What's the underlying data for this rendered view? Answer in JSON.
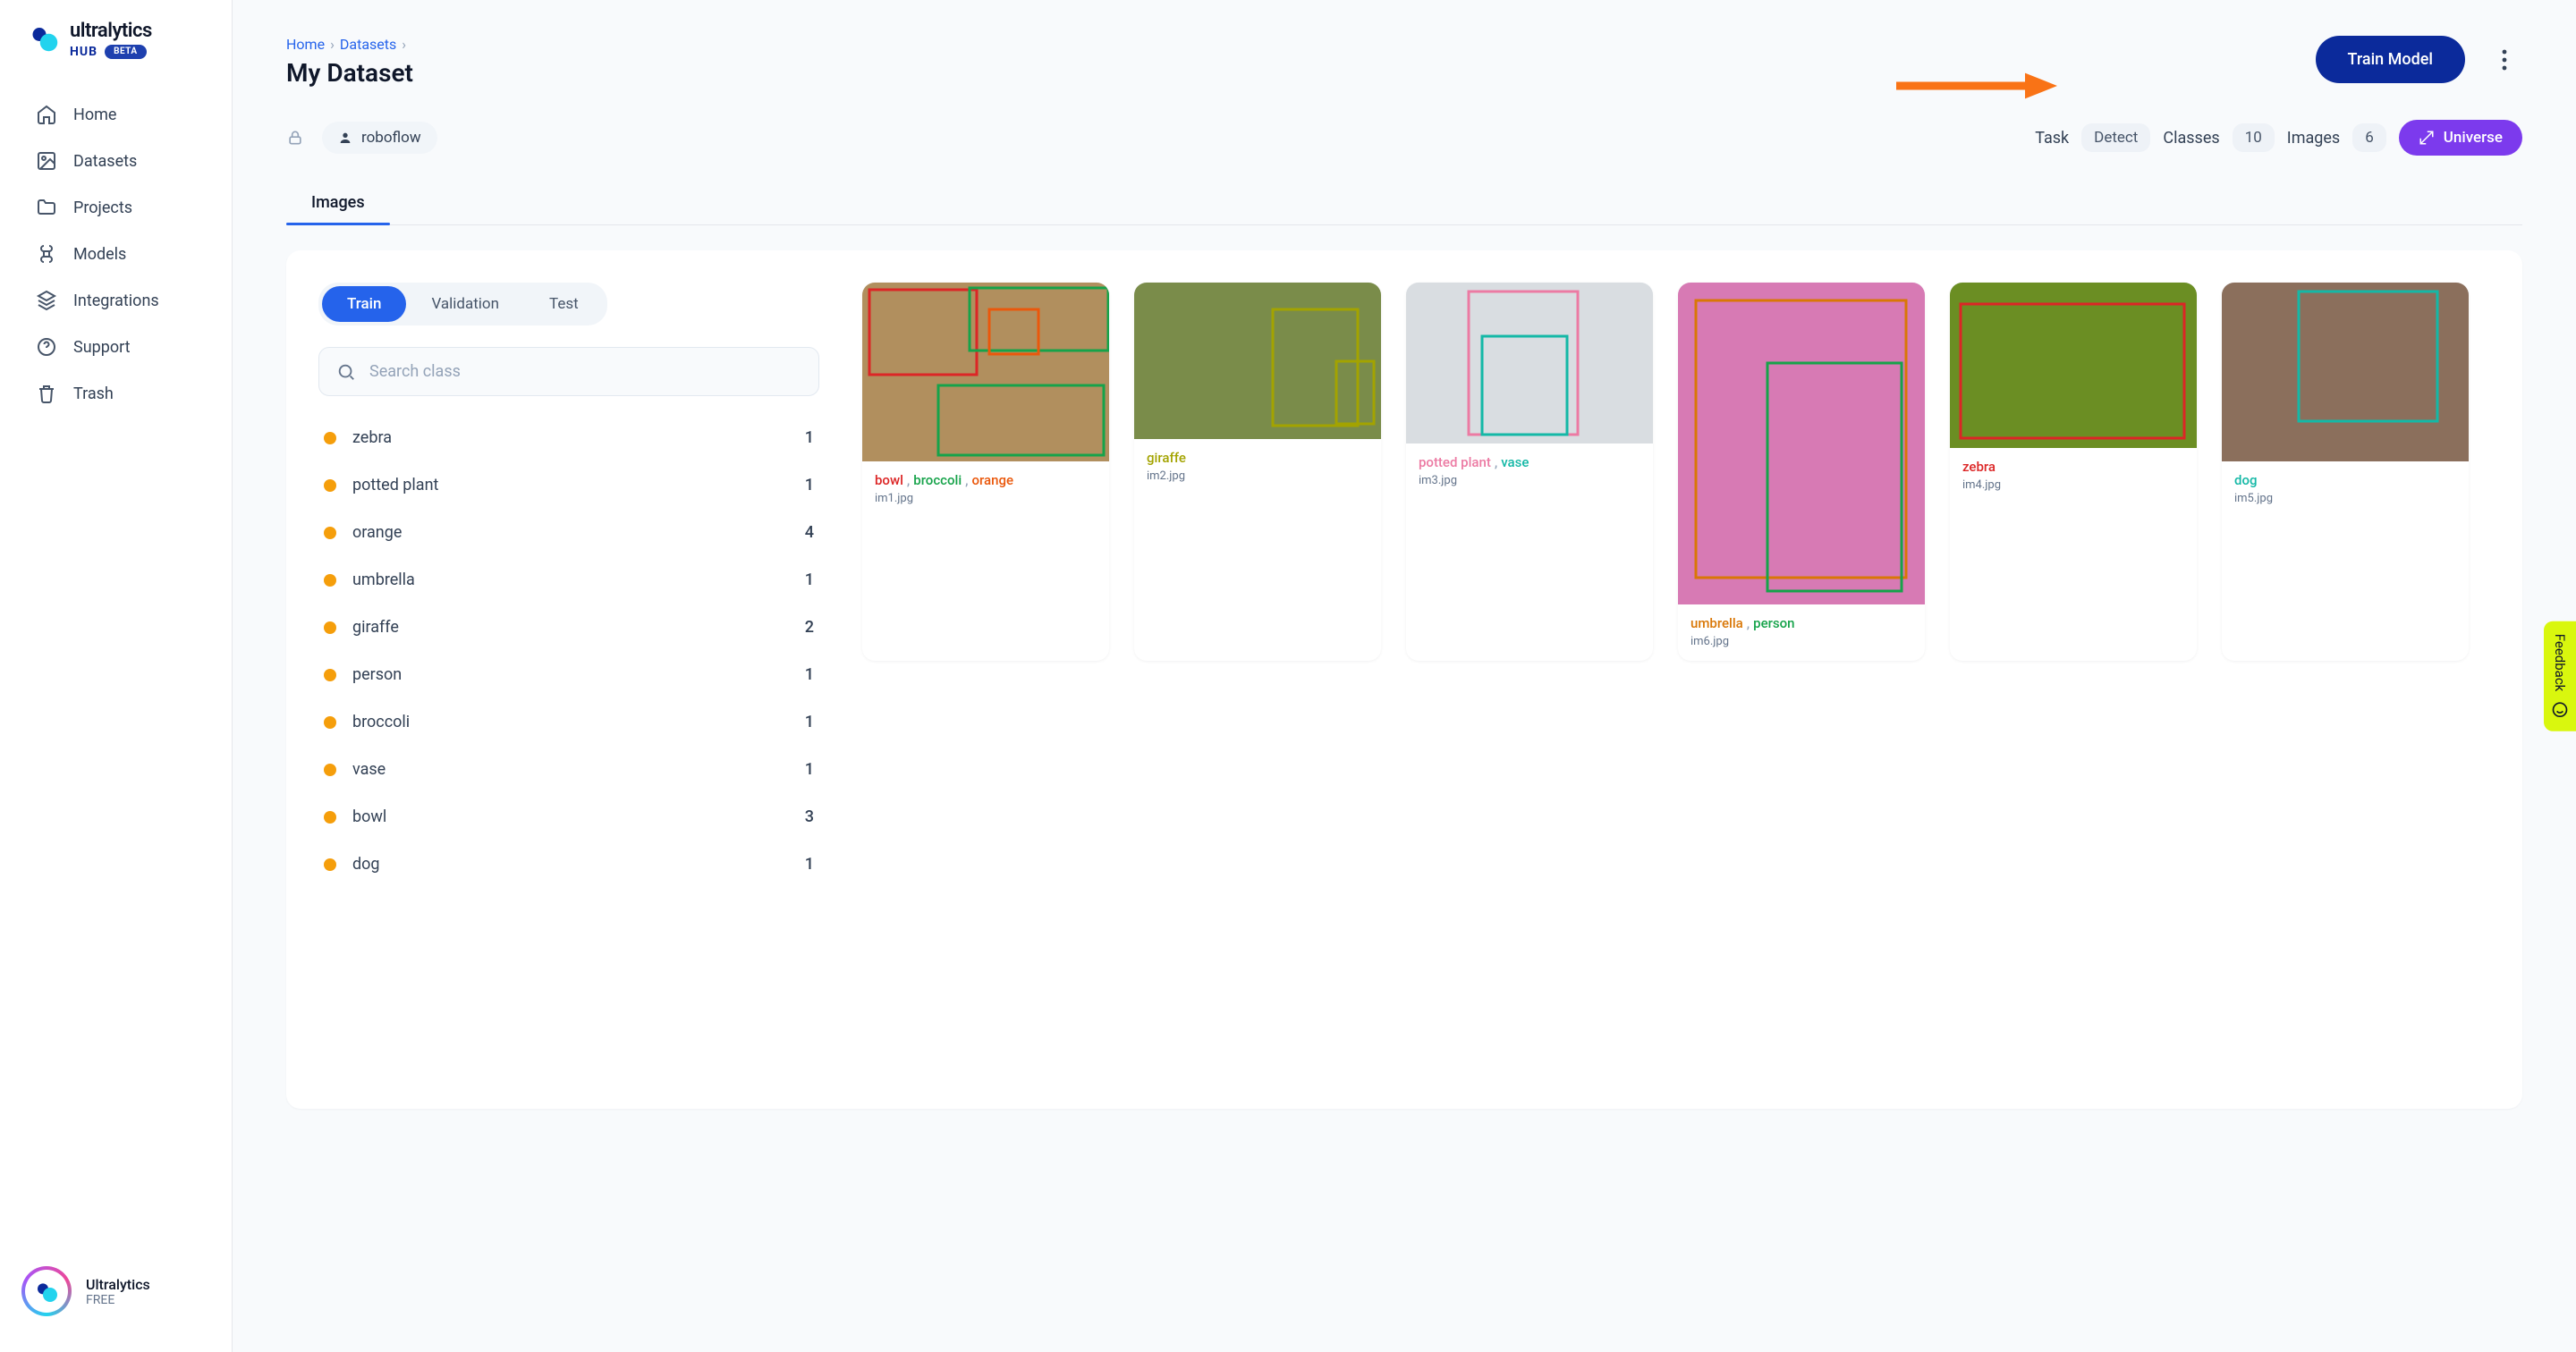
{
  "brand": {
    "name": "ultralytics",
    "sub": "HUB",
    "badge": "BETA"
  },
  "nav": [
    {
      "label": "Home"
    },
    {
      "label": "Datasets"
    },
    {
      "label": "Projects"
    },
    {
      "label": "Models"
    },
    {
      "label": "Integrations"
    },
    {
      "label": "Support"
    },
    {
      "label": "Trash"
    }
  ],
  "user": {
    "name": "Ultralytics",
    "tier": "FREE"
  },
  "breadcrumbs": {
    "home": "Home",
    "datasets": "Datasets"
  },
  "page_title": "My Dataset",
  "actions": {
    "train": "Train Model"
  },
  "owner": {
    "name": "roboflow"
  },
  "meta": {
    "task_label": "Task",
    "task_value": "Detect",
    "classes_label": "Classes",
    "classes_value": "10",
    "images_label": "Images",
    "images_value": "6",
    "universe_label": "Universe"
  },
  "tabs": {
    "images": "Images"
  },
  "splits": {
    "train": "Train",
    "val": "Validation",
    "test": "Test"
  },
  "search": {
    "placeholder": "Search class"
  },
  "classes": [
    {
      "name": "zebra",
      "count": "1"
    },
    {
      "name": "potted plant",
      "count": "1"
    },
    {
      "name": "orange",
      "count": "4"
    },
    {
      "name": "umbrella",
      "count": "1"
    },
    {
      "name": "giraffe",
      "count": "2"
    },
    {
      "name": "person",
      "count": "1"
    },
    {
      "name": "broccoli",
      "count": "1"
    },
    {
      "name": "vase",
      "count": "1"
    },
    {
      "name": "bowl",
      "count": "3"
    },
    {
      "name": "dog",
      "count": "1"
    }
  ],
  "cards": [
    {
      "filename": "im1.jpg",
      "labels": [
        {
          "t": "bowl",
          "c": "c-red"
        },
        {
          "t": "broccoli",
          "c": "c-green"
        },
        {
          "t": "orange",
          "c": "c-orange"
        }
      ]
    },
    {
      "filename": "im2.jpg",
      "labels": [
        {
          "t": "giraffe",
          "c": "c-olive"
        }
      ]
    },
    {
      "filename": "im3.jpg",
      "labels": [
        {
          "t": "potted plant",
          "c": "c-pink"
        },
        {
          "t": "vase",
          "c": "c-teal"
        }
      ]
    },
    {
      "filename": "im6.jpg",
      "labels": [
        {
          "t": "umbrella",
          "c": "c-amber"
        },
        {
          "t": "person",
          "c": "c-green"
        }
      ]
    },
    {
      "filename": "im4.jpg",
      "labels": [
        {
          "t": "zebra",
          "c": "c-red"
        }
      ]
    },
    {
      "filename": "im5.jpg",
      "labels": [
        {
          "t": "dog",
          "c": "c-teal"
        }
      ]
    }
  ],
  "feedback": "Feedback"
}
